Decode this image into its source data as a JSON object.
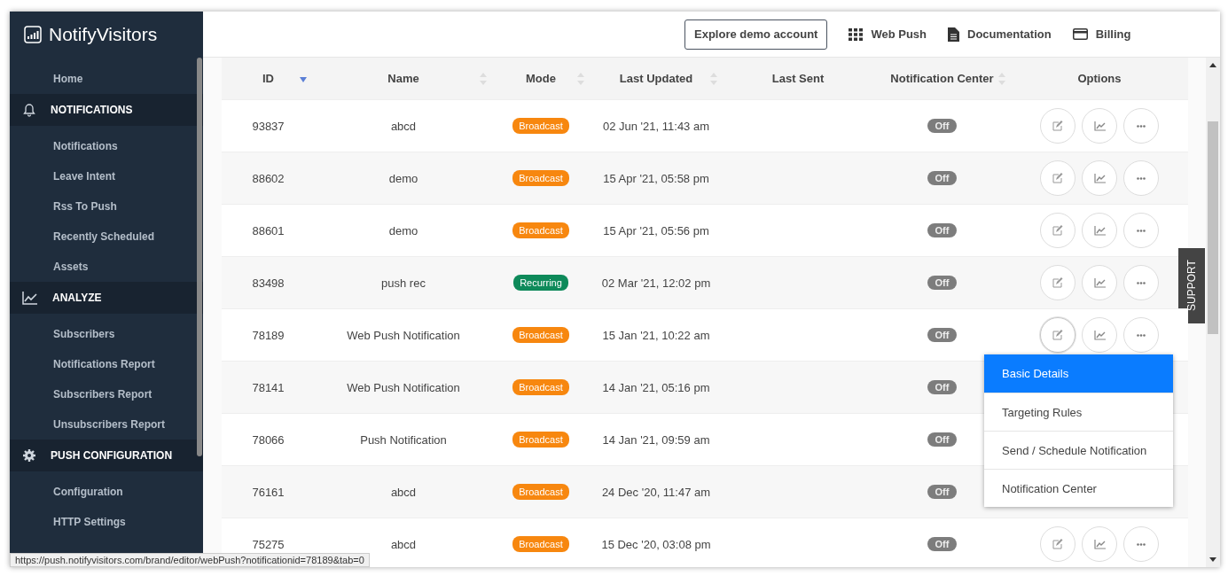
{
  "sidebar": {
    "logo": "NotifyVisitors",
    "nav": [
      {
        "kind": "link",
        "label": "Home"
      },
      {
        "kind": "section",
        "label": "NOTIFICATIONS"
      },
      {
        "kind": "link",
        "label": "Notifications"
      },
      {
        "kind": "link",
        "label": "Leave Intent"
      },
      {
        "kind": "link",
        "label": "Rss To Push"
      },
      {
        "kind": "link",
        "label": "Recently Scheduled"
      },
      {
        "kind": "link",
        "label": "Assets"
      },
      {
        "kind": "section",
        "label": "ANALYZE"
      },
      {
        "kind": "link",
        "label": "Subscribers"
      },
      {
        "kind": "link",
        "label": "Notifications Report"
      },
      {
        "kind": "link",
        "label": "Subscribers Report"
      },
      {
        "kind": "link",
        "label": "Unsubscribers Report"
      },
      {
        "kind": "section",
        "label": "PUSH CONFIGURATION"
      },
      {
        "kind": "link",
        "label": "Configuration"
      },
      {
        "kind": "link",
        "label": "HTTP Settings"
      }
    ]
  },
  "header": {
    "demo_button": "Explore demo account",
    "links": [
      "Web Push",
      "Documentation",
      "Billing"
    ]
  },
  "table": {
    "columns": [
      {
        "label": "ID",
        "kind": "sorted"
      },
      {
        "label": "Name",
        "kind": "sortable"
      },
      {
        "label": "Mode",
        "kind": "sortable"
      },
      {
        "label": "Last Updated",
        "kind": "sortable"
      },
      {
        "label": "Last Sent",
        "kind": "plain"
      },
      {
        "label": "Notification Center",
        "kind": "sortable"
      },
      {
        "label": "Options",
        "kind": "plain"
      }
    ],
    "rows": [
      {
        "id": "93837",
        "name": "abcd",
        "mode": {
          "kind": "broadcast",
          "label": "Broadcast"
        },
        "updated": "02 Jun '21, 11:43 am",
        "center": {
          "on": false,
          "label": "Off"
        },
        "menu_open": false
      },
      {
        "id": "88602",
        "name": "demo",
        "mode": {
          "kind": "broadcast",
          "label": "Broadcast"
        },
        "updated": "15 Apr '21, 05:58 pm",
        "center": {
          "on": false,
          "label": "Off"
        },
        "menu_open": false
      },
      {
        "id": "88601",
        "name": "demo",
        "mode": {
          "kind": "broadcast",
          "label": "Broadcast"
        },
        "updated": "15 Apr '21, 05:56 pm",
        "center": {
          "on": false,
          "label": "Off"
        },
        "menu_open": false
      },
      {
        "id": "83498",
        "name": "push rec",
        "mode": {
          "kind": "recurring",
          "label": "Recurring"
        },
        "updated": "02 Mar '21, 12:02 pm",
        "center": {
          "on": false,
          "label": "Off"
        },
        "menu_open": false
      },
      {
        "id": "78189",
        "name": "Web Push Notification",
        "mode": {
          "kind": "broadcast",
          "label": "Broadcast"
        },
        "updated": "15 Jan '21, 10:22 am",
        "center": {
          "on": false,
          "label": "Off"
        },
        "menu_open": true
      },
      {
        "id": "78141",
        "name": "Web Push Notification",
        "mode": {
          "kind": "broadcast",
          "label": "Broadcast"
        },
        "updated": "14 Jan '21, 05:16 pm",
        "center": {
          "on": false,
          "label": "Off"
        },
        "menu_open": false
      },
      {
        "id": "78066",
        "name": "Push Notification",
        "mode": {
          "kind": "broadcast",
          "label": "Broadcast"
        },
        "updated": "14 Jan '21, 09:59 am",
        "center": {
          "on": false,
          "label": "Off"
        },
        "menu_open": false
      },
      {
        "id": "76161",
        "name": "abcd",
        "mode": {
          "kind": "broadcast",
          "label": "Broadcast"
        },
        "updated": "24 Dec '20, 11:47 am",
        "center": {
          "on": false,
          "label": "Off"
        },
        "menu_open": false
      },
      {
        "id": "75275",
        "name": "abcd",
        "mode": {
          "kind": "broadcast",
          "label": "Broadcast"
        },
        "updated": "15 Dec '20, 03:08 pm",
        "center": {
          "on": false,
          "label": "Off"
        },
        "menu_open": false
      }
    ]
  },
  "menu": {
    "items": [
      {
        "label": "Basic Details",
        "selected": true
      },
      {
        "label": "Targeting Rules",
        "selected": false
      },
      {
        "label": "Send / Schedule Notification",
        "selected": false
      },
      {
        "label": "Notification Center",
        "selected": false
      }
    ]
  },
  "support_tab": "SUPPORT",
  "status_url": "https://push.notifyvisitors.com/brand/editor/webPush?notificationid=78189&tab=0"
}
